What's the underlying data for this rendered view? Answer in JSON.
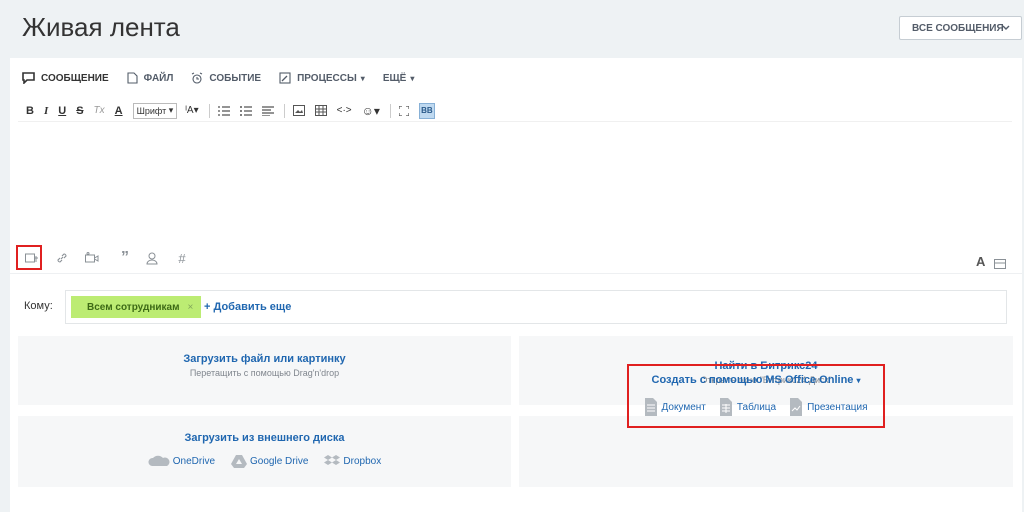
{
  "header": {
    "title": "Живая лента",
    "filter_label": "ВСЕ СООБЩЕНИЯ"
  },
  "tabs": [
    {
      "label": "СООБЩЕНИЕ",
      "icon": "message-icon"
    },
    {
      "label": "ФАЙЛ",
      "icon": "file-icon"
    },
    {
      "label": "СОБЫТИЕ",
      "icon": "alarm-clock-icon"
    },
    {
      "label": "ПРОЦЕССЫ",
      "icon": "process-icon"
    },
    {
      "label": "ЕЩЁ",
      "icon": ""
    }
  ],
  "toolbar": {
    "bold": "B",
    "italic": "I",
    "underline": "U",
    "strike": "S",
    "clear_format": "Tx",
    "font_color": "A",
    "font_select": "Шрифт",
    "font_size": "A",
    "bbcode": "BB"
  },
  "attach_bar": {
    "icons": [
      "attach-file-icon",
      "link-icon",
      "video-icon",
      "quote-icon",
      "mention-icon",
      "hashtag-icon"
    ],
    "format_label": "A"
  },
  "recipients": {
    "label": "Кому:",
    "tag": "Всем сотрудникам",
    "tag_remove": "×",
    "add_more": "+ Добавить еще"
  },
  "upload": {
    "local_title": "Загрузить файл или картинку",
    "local_sub": "Перетащить с помощью Drag'n'drop",
    "bitrix_title": "Найти в Битрикс24",
    "bitrix_sub": "Открыть окно \"Битрикс24.Диск\"",
    "external_title": "Загрузить из внешнего диска",
    "external_drives": [
      "OneDrive",
      "Google Drive",
      "Dropbox"
    ],
    "office_title": "Создать с помощью MS Office Online",
    "office_items": [
      "Документ",
      "Таблица",
      "Презентация"
    ]
  },
  "colors": {
    "accent_link": "#2067b0",
    "tag_bg": "#bcec73",
    "highlight": "#e02020"
  }
}
